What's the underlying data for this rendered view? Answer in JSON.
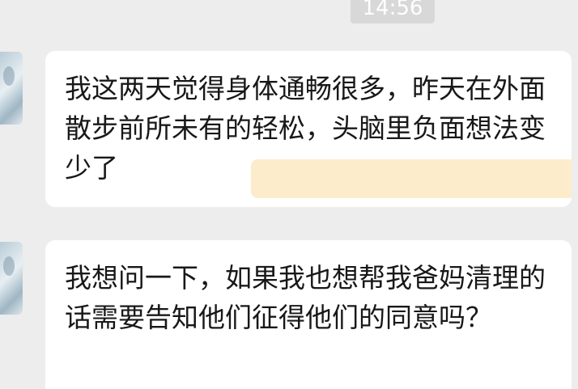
{
  "chat": {
    "timestamp": "14:56",
    "messages": [
      {
        "text": "我这两天觉得身体通畅很多，昨天在外面散步前所未有的轻松，头脑里负面想法变少了"
      },
      {
        "text": "我想问一下，如果我也想帮我爸妈清理的话需要告知他们征得他们的同意吗？"
      }
    ],
    "colors": {
      "background": "#ededed",
      "bubble": "#ffffff",
      "highlight": "#fdeccc",
      "text": "#181818",
      "timestamp_bg": "#d8d8d8"
    }
  }
}
